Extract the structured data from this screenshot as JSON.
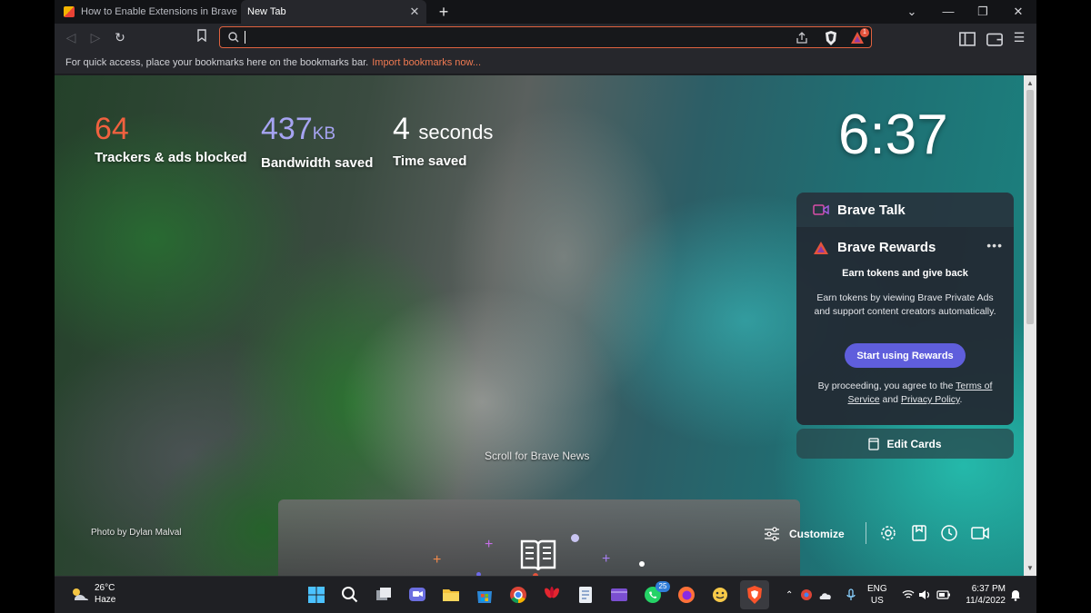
{
  "tabs": [
    {
      "title": "How to Enable Extensions in Brave Inc",
      "active": false
    },
    {
      "title": "New Tab",
      "active": true
    }
  ],
  "address_bar": {
    "value": "",
    "placeholder": ""
  },
  "shields_badge": "1",
  "bookmarks_bar": {
    "hint": "For quick access, place your bookmarks here on the bookmarks bar.",
    "import_link": "Import bookmarks now..."
  },
  "stats": {
    "trackers": {
      "value": "64",
      "label": "Trackers & ads blocked",
      "color": "#f0613f"
    },
    "bandwidth": {
      "value": "437",
      "unit": "KB",
      "label": "Bandwidth saved",
      "color": "#a6a4f2"
    },
    "time": {
      "value": "4",
      "unit": "seconds",
      "label": "Time saved",
      "color": "#ffffff"
    }
  },
  "clock": "6:37",
  "brave_talk": {
    "title": "Brave Talk"
  },
  "brave_rewards": {
    "title": "Brave Rewards",
    "menu": "•••",
    "subtitle": "Earn tokens and give back",
    "description": "Earn tokens by viewing Brave Private Ads and support content creators automatically.",
    "button": "Start using Rewards",
    "legal_prefix": "By proceeding, you agree to the",
    "terms": "Terms of Service",
    "legal_and": "and",
    "privacy": "Privacy Policy",
    "legal_suffix": ".",
    "accent": "#5f5edc"
  },
  "edit_cards": "Edit Cards",
  "scroll_news": "Scroll for Brave News",
  "photo_credit": "Photo by Dylan Malval",
  "customize": "Customize",
  "taskbar": {
    "weather_temp": "26°C",
    "weather_desc": "Haze",
    "whatsapp_badge": "25",
    "lang_1": "ENG",
    "lang_2": "US",
    "time": "6:37 PM",
    "date": "11/4/2022"
  }
}
